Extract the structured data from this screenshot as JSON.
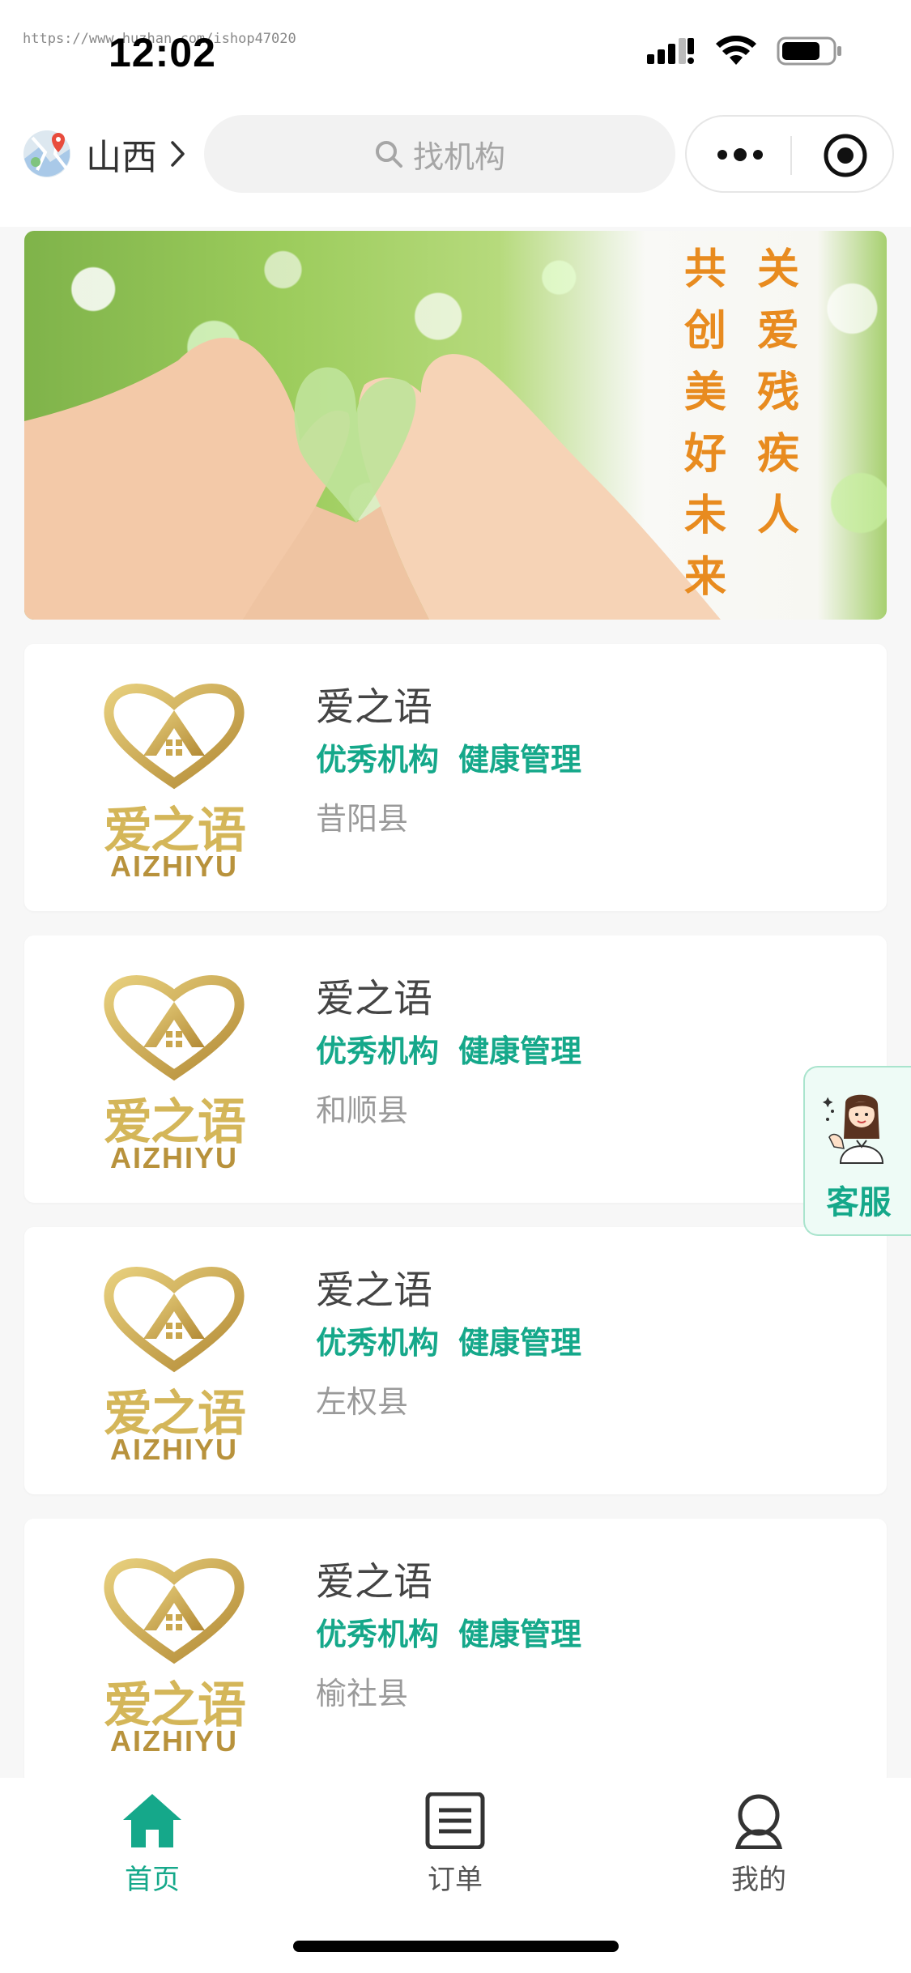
{
  "status_bar": {
    "watermark": "https://www.huzhan.com/ishop47020",
    "time": "12:02"
  },
  "nav": {
    "region": "山西",
    "search_placeholder": "找机构"
  },
  "banner": {
    "slogan_col1": [
      "关",
      "爱",
      "残",
      "疾",
      "人"
    ],
    "slogan_col2": [
      "共",
      "创",
      "美",
      "好",
      "未",
      "来"
    ]
  },
  "logo": {
    "cn": "爱之语",
    "en": "AIZHIYU"
  },
  "institutions": [
    {
      "name": "爱之语",
      "tags": [
        "优秀机构",
        "健康管理"
      ],
      "location": "昔阳县"
    },
    {
      "name": "爱之语",
      "tags": [
        "优秀机构",
        "健康管理"
      ],
      "location": "和顺县"
    },
    {
      "name": "爱之语",
      "tags": [
        "优秀机构",
        "健康管理"
      ],
      "location": "左权县"
    },
    {
      "name": "爱之语",
      "tags": [
        "优秀机构",
        "健康管理"
      ],
      "location": "榆社县"
    }
  ],
  "customer_service": {
    "label": "客服"
  },
  "tabbar": {
    "items": [
      {
        "label": "首页",
        "icon": "home-icon",
        "active": true
      },
      {
        "label": "订单",
        "icon": "order-list-icon",
        "active": false
      },
      {
        "label": "我的",
        "icon": "profile-icon",
        "active": false
      }
    ]
  },
  "colors": {
    "accent": "#15a88a",
    "logo_gold": "#d4b659",
    "slogan_orange": "#e88b1f"
  }
}
